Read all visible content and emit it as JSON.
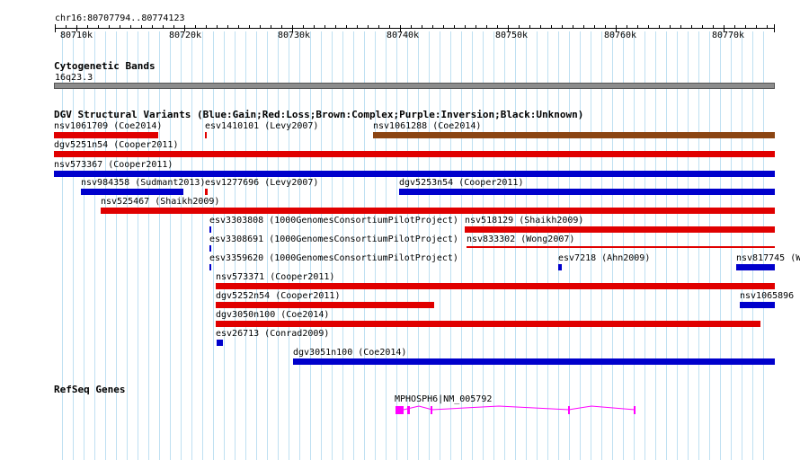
{
  "ruler": {
    "coordinates": "chr16:80707794..80774123",
    "ticks": [
      "80710k",
      "80720k",
      "80730k",
      "80740k",
      "80750k",
      "80760k",
      "80770k"
    ]
  },
  "cytoband": {
    "title": "Cytogenetic Bands",
    "band": "16q23.3"
  },
  "dgv": {
    "title": "DGV Structural Variants (Blue:Gain;Red:Loss;Brown:Complex;Purple:Inversion;Black:Unknown)",
    "colors": {
      "gain": "#0000cc",
      "loss": "#e00000",
      "complex": "#8b4513"
    },
    "variants": [
      {
        "label": "nsv1061709 (Coe2014)",
        "type": "loss"
      },
      {
        "label": "esv1410101 (Levy2007)",
        "type": "loss"
      },
      {
        "label": "nsv1061288 (Coe2014)",
        "type": "complex"
      },
      {
        "label": "dgv5251n54 (Cooper2011)",
        "type": "loss"
      },
      {
        "label": "nsv573367 (Cooper2011)",
        "type": "gain"
      },
      {
        "label": "nsv984358 (Sudmant2013)",
        "type": "gain"
      },
      {
        "label": "esv1277696 (Levy2007)",
        "type": "loss"
      },
      {
        "label": "dgv5253n54 (Cooper2011)",
        "type": "gain"
      },
      {
        "label": "nsv525467 (Shaikh2009)",
        "type": "loss"
      },
      {
        "label": "esv3303808 (1000GenomesConsortiumPilotProject)",
        "type": "gain"
      },
      {
        "label": "nsv518129 (Shaikh2009)",
        "type": "loss"
      },
      {
        "label": "esv3308691 (1000GenomesConsortiumPilotProject)",
        "type": "gain"
      },
      {
        "label": "nsv833302 (Wong2007)",
        "type": "loss"
      },
      {
        "label": "esv3359620 (1000GenomesConsortiumPilotProject)",
        "type": "gain"
      },
      {
        "label": "esv7218 (Ahn2009)",
        "type": "gain"
      },
      {
        "label": "nsv817745 (W",
        "type": "gain"
      },
      {
        "label": "nsv573371 (Cooper2011)",
        "type": "loss"
      },
      {
        "label": "dgv5252n54 (Cooper2011)",
        "type": "loss"
      },
      {
        "label": "nsv1065896",
        "type": "gain"
      },
      {
        "label": "dgv3050n100 (Coe2014)",
        "type": "loss"
      },
      {
        "label": "esv26713 (Conrad2009)",
        "type": "gain"
      },
      {
        "label": "dgv3051n100 (Coe2014)",
        "type": "gain"
      }
    ]
  },
  "refseq": {
    "title": "RefSeq Genes",
    "gene_label": "MPHOSPH6|NM_005792",
    "color": "#ff00ff"
  }
}
